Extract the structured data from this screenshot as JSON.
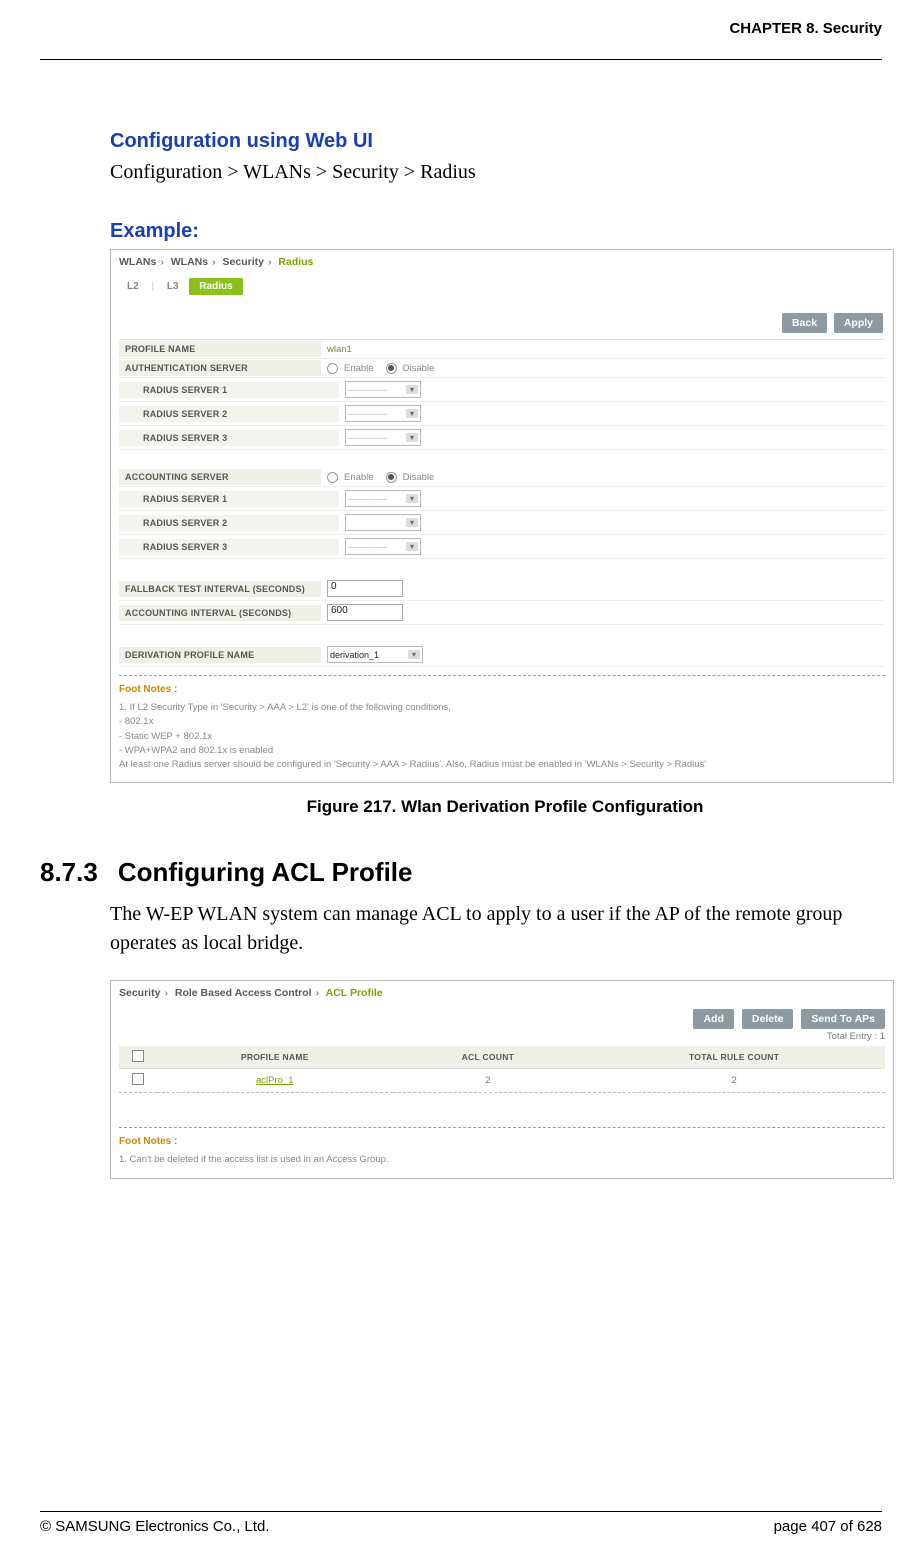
{
  "header": {
    "chapter": "CHAPTER 8. Security"
  },
  "sec1": {
    "title": "Configuration using Web UI",
    "breadcrumb": "Configuration > WLANs > Security > Radius",
    "example_label": "Example:"
  },
  "fig1": {
    "bc": {
      "a": "WLANs",
      "b": "WLANs",
      "c": "Security",
      "d": "Radius",
      "sep": "›"
    },
    "tabs": {
      "l2": "L2",
      "l3": "L3",
      "radius": "Radius"
    },
    "buttons": {
      "back": "Back",
      "apply": "Apply"
    },
    "labels": {
      "profile_name": "PROFILE NAME",
      "auth_server": "AUTHENTICATION SERVER",
      "rs1": "RADIUS SERVER 1",
      "rs2": "RADIUS SERVER 2",
      "rs3": "RADIUS SERVER 3",
      "acct_server": "ACCOUNTING SERVER",
      "fallback": "FALLBACK TEST INTERVAL (SECONDS)",
      "acct_interval": "ACCOUNTING INTERVAL (SECONDS)",
      "deriv": "DERIVATION PROFILE NAME"
    },
    "values": {
      "profile_name": "wlan1",
      "enable": "Enable",
      "disable": "Disable",
      "placeholder": "-------------",
      "fallback": "0",
      "acct_interval": "600",
      "deriv": "derivation_1"
    },
    "footnotes": {
      "title": "Foot Notes :",
      "l1": "1. If L2 Security Type in 'Security > AAA > L2' is one of the following conditions,",
      "l2": "- 802.1x",
      "l3": "- Static WEP + 802.1x",
      "l4": "- WPA+WPA2 and 802.1x is enabled",
      "l5": "At least one Radius server should be configured in 'Security > AAA > Radius'. Also, Radius must be enabled in 'WLANs > Security > Radius'"
    },
    "caption": "Figure 217. Wlan Derivation Profile Configuration"
  },
  "sec2": {
    "number": "8.7.3",
    "title": "Configuring ACL Profile",
    "body": "The W-EP WLAN system can manage ACL to apply to a user if the AP of the remote group operates as local bridge."
  },
  "fig2": {
    "bc": {
      "a": "Security",
      "b": "Role Based Access Control",
      "c": "ACL Profile",
      "sep": "›"
    },
    "buttons": {
      "add": "Add",
      "delete": "Delete",
      "send": "Send To APs"
    },
    "total_label": "Total Entry : ",
    "total_value": "1",
    "cols": {
      "name": "PROFILE NAME",
      "count": "ACL COUNT",
      "rule": "TOTAL RULE COUNT"
    },
    "row": {
      "name": "aclPro_1",
      "count": "2",
      "rule": "2"
    },
    "footnotes": {
      "title": "Foot Notes :",
      "l1": "1. Can't be deleted if the access list is used in an Access Group."
    }
  },
  "footer": {
    "left": "© SAMSUNG Electronics Co., Ltd.",
    "right": "page 407 of 628"
  }
}
